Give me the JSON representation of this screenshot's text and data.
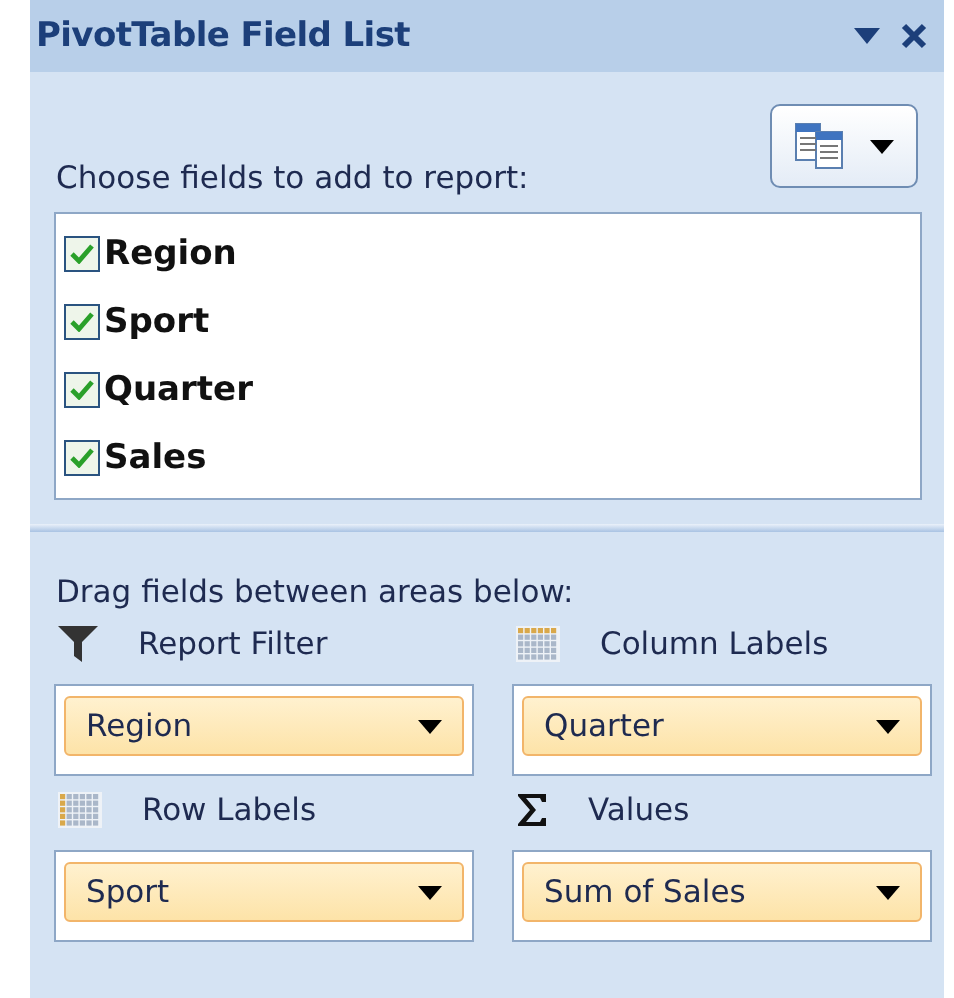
{
  "title": "PivotTable Field List",
  "choose_label": "Choose fields to add to report:",
  "fields": [
    {
      "name": "Region",
      "checked": true
    },
    {
      "name": "Sport",
      "checked": true
    },
    {
      "name": "Quarter",
      "checked": true
    },
    {
      "name": "Sales",
      "checked": true
    }
  ],
  "drag_label": "Drag fields between areas below:",
  "areas": [
    {
      "kind": "filter",
      "label": "Report Filter",
      "items": [
        "Region"
      ]
    },
    {
      "kind": "columns",
      "label": "Column Labels",
      "items": [
        "Quarter"
      ]
    },
    {
      "kind": "rows",
      "label": "Row Labels",
      "items": [
        "Sport"
      ]
    },
    {
      "kind": "values",
      "label": "Values",
      "items": [
        "Sum of Sales"
      ]
    }
  ]
}
